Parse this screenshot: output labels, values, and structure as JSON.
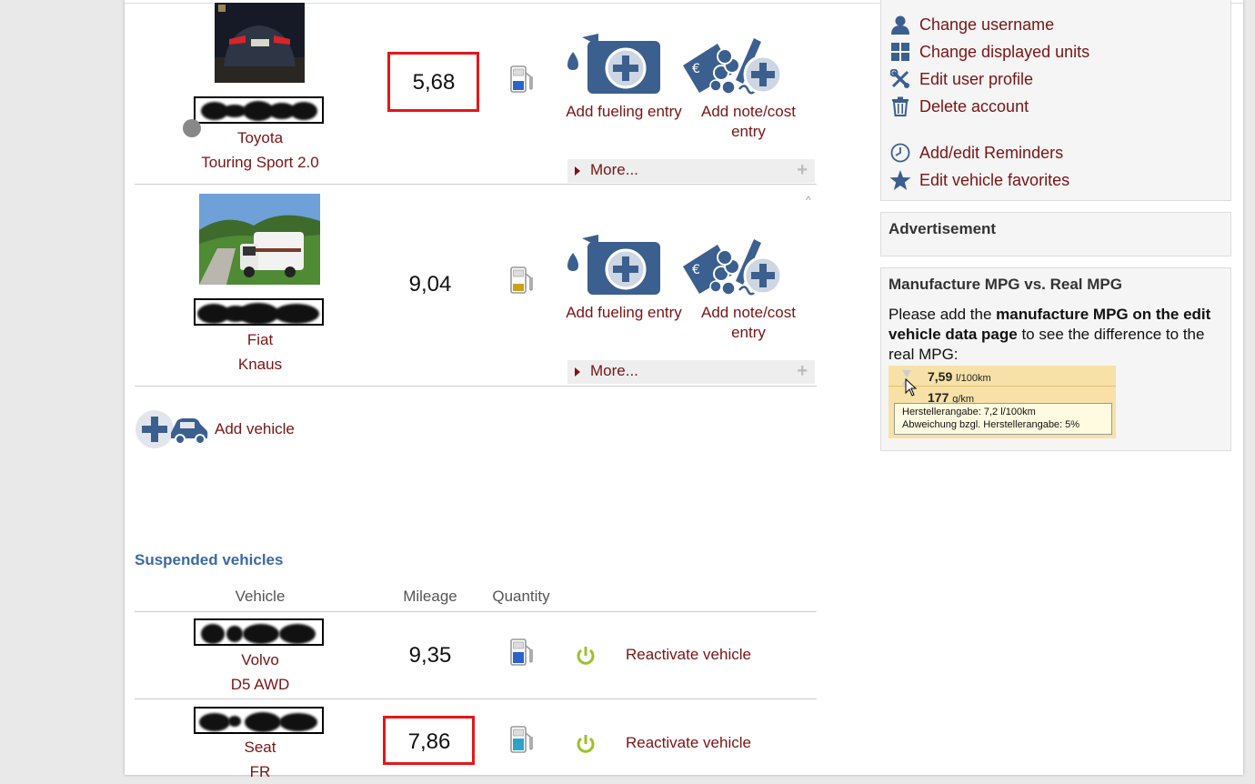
{
  "account_menu": {
    "items": [
      {
        "label": "Change username",
        "icon": "user-icon"
      },
      {
        "label": "Change displayed units",
        "icon": "grid-icon"
      },
      {
        "label": "Edit user profile",
        "icon": "tools-icon"
      },
      {
        "label": "Delete account",
        "icon": "trash-icon"
      },
      {
        "label": "Add/edit Reminders",
        "icon": "clock-icon"
      },
      {
        "label": "Edit vehicle favorites",
        "icon": "star-icon"
      }
    ]
  },
  "advertisement": {
    "title": "Advertisement"
  },
  "mpg_box": {
    "title": "Manufacture MPG vs. Real MPG",
    "text_before": "Please add the ",
    "text_bold": "manufacture MPG on the edit vehicle data page",
    "text_after": " to see the difference to the real MPG:",
    "sample": {
      "value1": "7,59",
      "unit1": "l/100km",
      "value2": "177",
      "unit2": "g/km",
      "tooltip_line1": "Herstellerangabe: 7,2 l/100km",
      "tooltip_line2": "Abweichung bzgl. Herstellerangabe: 5%"
    }
  },
  "vehicles": [
    {
      "make": "Toyota",
      "model": "Touring Sport 2.0",
      "mileage": "5,68",
      "add_fueling": "Add fueling entry",
      "add_note": "Add note/cost entry",
      "more": "More..."
    },
    {
      "make": "Fiat",
      "model": "Knaus",
      "mileage": "9,04",
      "add_fueling": "Add fueling entry",
      "add_note": "Add note/cost entry",
      "more": "More..."
    }
  ],
  "add_vehicle": "Add vehicle",
  "suspended": {
    "title": "Suspended vehicles",
    "headers": {
      "vehicle": "Vehicle",
      "mileage": "Mileage",
      "quantity": "Quantity"
    },
    "rows": [
      {
        "make": "Volvo",
        "model": "D5 AWD",
        "mileage": "9,35",
        "action": "Reactivate vehicle"
      },
      {
        "make": "Seat",
        "model": "FR",
        "mileage": "7,86",
        "action": "Reactivate vehicle"
      }
    ]
  },
  "colors": {
    "link": "#7a1414",
    "icon_blue": "#3b5f8e",
    "highlight": "#e5161a",
    "power_green": "#9ac32b"
  }
}
